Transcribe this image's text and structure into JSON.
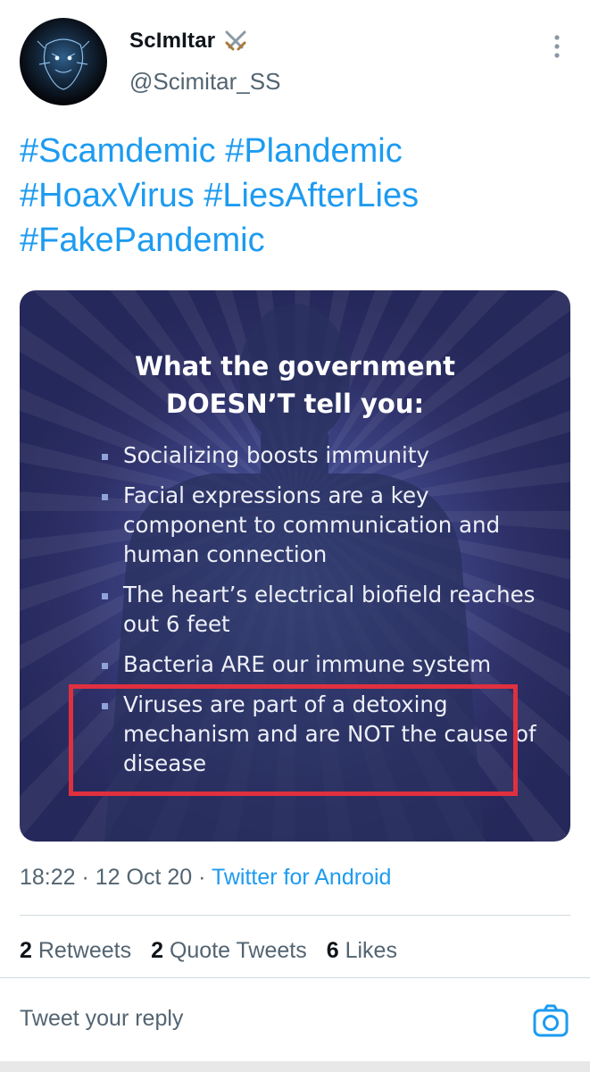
{
  "tweet": {
    "author": {
      "display_name": "ScImItar",
      "handle": "@Scimitar_SS"
    },
    "hashtags": [
      "#Scamdemic #Plandemic",
      "#HoaxVirus #LiesAfterLies",
      "#FakePandemic"
    ],
    "media": {
      "title_line1": "What the government",
      "title_line2": "DOESN’T tell you:",
      "bullets": [
        "Socializing boosts immunity",
        "Facial expressions are a key component to communication and human connection",
        "The heart’s electrical biofield reaches out 6 feet",
        "Bacteria ARE our immune system",
        "Viruses are part of a detoxing mechanism and are NOT the cause of disease"
      ],
      "highlight_color": "#e0303f"
    },
    "time": "18:22",
    "date": "12 Oct 20",
    "separator": " · ",
    "source": "Twitter for Android",
    "stats": {
      "retweets_count": "2",
      "retweets_label": "Retweets",
      "quotes_count": "2",
      "quotes_label": "Quote Tweets",
      "likes_count": "6",
      "likes_label": "Likes"
    }
  },
  "reply": {
    "placeholder": "Tweet your reply"
  },
  "colors": {
    "accent": "#1d9bf0",
    "secondary_text": "#536471"
  }
}
